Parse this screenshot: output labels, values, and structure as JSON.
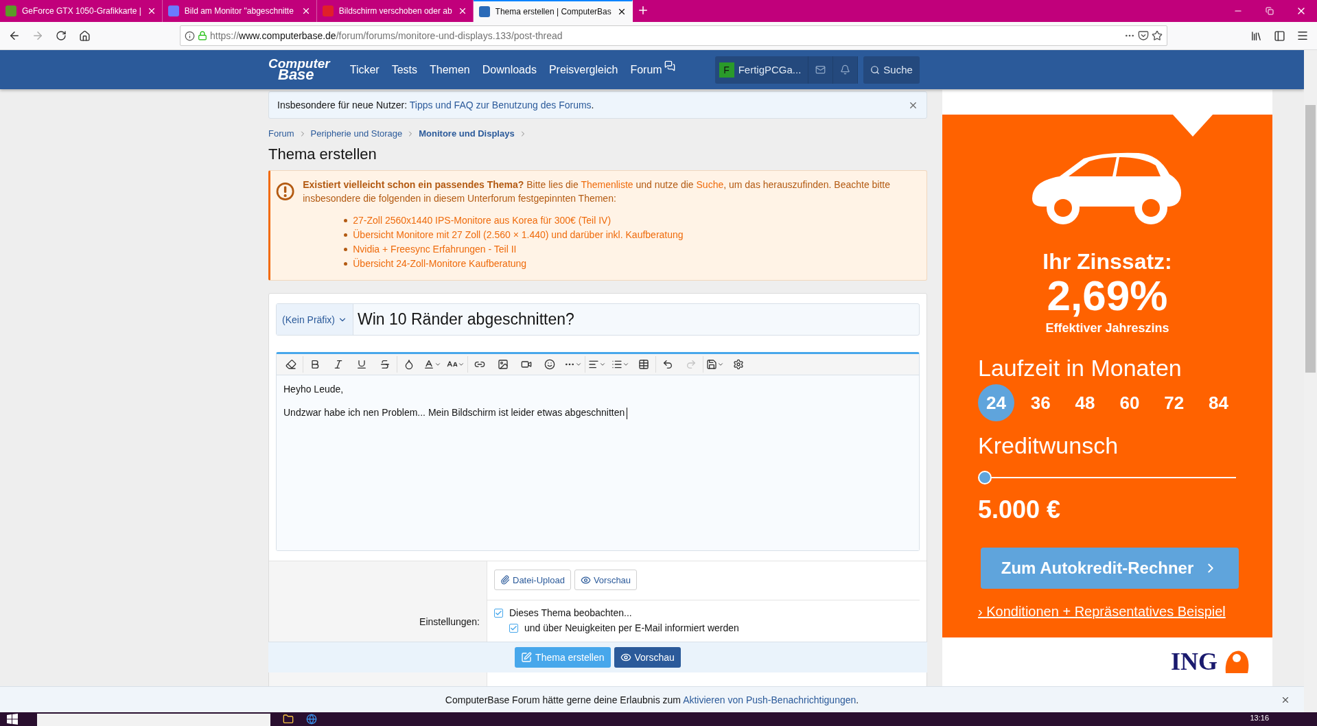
{
  "browser": {
    "tabs": [
      {
        "title": "GeForce GTX 1050-Grafikkarte |",
        "selected": false
      },
      {
        "title": "Bild am Monitor \"abgeschnitte",
        "selected": false
      },
      {
        "title": "Bildschirm verschoben oder ab",
        "selected": false
      },
      {
        "title": "Thema erstellen | ComputerBas",
        "selected": true
      }
    ],
    "url": {
      "scheme": "https://",
      "host": "www.computerbase.de",
      "path": "/forum/forums/monitore-und-displays.133/post-thread"
    }
  },
  "site_nav": {
    "logo": [
      "Computer",
      "Base"
    ],
    "links": [
      "Ticker",
      "Tests",
      "Themen",
      "Downloads",
      "Preisvergleich",
      "Forum"
    ],
    "user": {
      "initial": "F",
      "name": "FertigPCGa..."
    },
    "search": "Suche"
  },
  "notice": {
    "label": "Insbesondere für neue Nutzer:",
    "link": "Tipps und FAQ zur Benutzung des Forums",
    "end": "."
  },
  "breadcrumb": [
    {
      "label": "Forum",
      "current": false
    },
    {
      "label": "Peripherie und Storage",
      "current": false
    },
    {
      "label": "Monitore und Displays",
      "current": true
    }
  ],
  "heading": "Thema erstellen",
  "alert": {
    "parts": [
      {
        "kind": "bold",
        "text": "Existiert vielleicht schon ein passendes Thema?"
      },
      {
        "kind": "plain",
        "text": " Bitte lies die "
      },
      {
        "kind": "link",
        "text": "Themenliste"
      },
      {
        "kind": "plain",
        "text": " und nutze die "
      },
      {
        "kind": "link",
        "text": "Suche"
      },
      {
        "kind": "plain",
        "text": ", um das herauszufinden. Beachte bitte insbesondere die folgenden in diesem Unterforum festgepinnten Themen:"
      }
    ],
    "items": [
      "27-Zoll 2560x1440 IPS-Monitore aus Korea für 300€ (Teil IV)",
      "Übersicht Monitore mit 27 Zoll (2.560 × 1.440) und darüber inkl. Kaufberatung",
      "Nvidia + Freesync Erfahrungen - Teil II",
      "Übersicht 24-Zoll-Monitore Kaufberatung"
    ]
  },
  "form": {
    "prefix": "(Kein Präfix)",
    "title": "Win 10 Ränder abgeschnitten?",
    "toolbar": {
      "redo_disabled": true
    },
    "body": [
      "Heyho Leude,",
      "Undzwar habe ich nen Problem... Mein Bildschirm ist leider etwas abgeschnitten"
    ],
    "attachments": [
      "Datei-Upload",
      "Vorschau"
    ],
    "settings_label": "Einstellungen:",
    "options": [
      {
        "label": "Dieses Thema beobachten...",
        "checked": true,
        "children": [
          {
            "label": "und über Neuigkeiten per E-Mail informiert werden",
            "checked": true
          }
        ]
      }
    ],
    "actions": [
      {
        "label": "Thema erstellen",
        "kind": "primary"
      },
      {
        "label": "Vorschau",
        "kind": "secondary"
      }
    ]
  },
  "ad": {
    "rate_label": "Ihr Zinssatz:",
    "rate": "2,69%",
    "rate_note": "Effektiver Jahreszins",
    "duration_label": "Laufzeit in Monaten",
    "durations": [
      {
        "label": "24",
        "selected": true
      },
      {
        "label": "36",
        "selected": false
      },
      {
        "label": "48",
        "selected": false
      },
      {
        "label": "60",
        "selected": false
      },
      {
        "label": "72",
        "selected": false
      },
      {
        "label": "84",
        "selected": false
      }
    ],
    "amount_label": "Kreditwunsch",
    "slider": {
      "level": 0
    },
    "amount": "5.000 €",
    "cta": "Zum Autokredit-Rechner",
    "link": "› Konditionen + Repräsentatives Beispiel",
    "logo": "ING"
  },
  "push_bar": {
    "text": "ComputerBase Forum hätte gerne deine Erlaubnis zum ",
    "link": "Aktivieren von Push-Benachrichtigungen",
    "end": "."
  },
  "taskbar": {
    "time": "13:16"
  }
}
